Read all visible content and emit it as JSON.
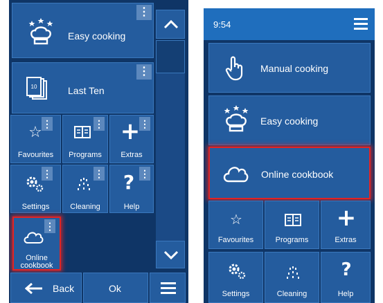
{
  "left": {
    "tiles": {
      "easy_cooking": "Easy cooking",
      "last_ten": "Last Ten",
      "last_ten_badge": "10",
      "favourites": "Favourites",
      "programs": "Programs",
      "extras": "Extras",
      "settings": "Settings",
      "cleaning": "Cleaning",
      "help": "Help",
      "online_cookbook_line1": "Online",
      "online_cookbook_line2": "cookbook"
    },
    "bottom": {
      "back": "Back",
      "ok": "Ok"
    },
    "kebab": "⋮",
    "icons": {
      "scroll_up": "chevron-up-icon",
      "scroll_down": "chevron-down-icon",
      "menu": "hamburger-menu-icon",
      "back": "arrow-left-icon"
    }
  },
  "right": {
    "status": {
      "time": "9:54"
    },
    "tiles": {
      "manual_cooking": "Manual cooking",
      "easy_cooking": "Easy cooking",
      "online_cookbook": "Online cookbook",
      "favourites": "Favourites",
      "programs": "Programs",
      "extras": "Extras",
      "settings": "Settings",
      "cleaning": "Cleaning",
      "help": "Help"
    },
    "glyphs": {
      "star": "☆",
      "plus": "+",
      "help": "?",
      "cleaning": "∴"
    }
  },
  "colors": {
    "background": "#0f3566",
    "tile": "#245c9e",
    "tile_border": "#3a78bd",
    "top_bar": "#1f6ebd",
    "selection": "#e02424"
  }
}
